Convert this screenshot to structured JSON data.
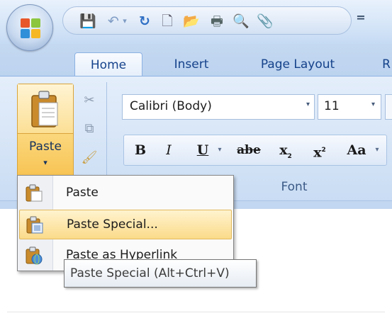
{
  "quick_access": {
    "save_glyph": "💾",
    "undo_glyph": "↶",
    "undo_dropdown_glyph": "▾",
    "redo_glyph": "↻",
    "new_glyph": "🗋",
    "open_glyph": "📂",
    "print_glyph": "🖶",
    "preview_glyph": "🔍",
    "attach_glyph": "📎",
    "customize_glyph": "="
  },
  "tabs": [
    {
      "label": "Home",
      "active": true
    },
    {
      "label": "Insert",
      "active": false
    },
    {
      "label": "Page Layout",
      "active": false
    },
    {
      "label": "R",
      "active": false
    }
  ],
  "clipboard": {
    "paste_label": "Paste",
    "paste_arrow": "▾",
    "cut_glyph": "✂",
    "copy_glyph": "⧉",
    "format_painter_glyph": "🖌"
  },
  "font": {
    "name": "Calibri (Body)",
    "size": "11",
    "dropdown_glyph": "▾",
    "group_label": "Font",
    "format_buttons": {
      "bold": "B",
      "italic": "I",
      "underline": "U",
      "strikethrough": "abe",
      "subscript": "x",
      "subscript_mark": "2",
      "superscript": "x",
      "superscript_mark": "2",
      "change_case": "Aa"
    }
  },
  "paste_menu": {
    "items": [
      {
        "label": "Paste",
        "icon": "paste-icon",
        "highlighted": false
      },
      {
        "label": "Paste Special...",
        "icon": "paste-special-icon",
        "highlighted": true
      },
      {
        "label": "Paste as Hyperlink",
        "icon": "paste-hyperlink-icon",
        "highlighted": false
      }
    ]
  },
  "tooltip": {
    "text": "Paste Special (Alt+Ctrl+V)"
  },
  "colors": {
    "ribbon_text": "#15428b",
    "highlight": "#fbdb8a",
    "office_logo": [
      "#e8572a",
      "#8cc63f",
      "#2f8fd8",
      "#f5b824"
    ]
  }
}
